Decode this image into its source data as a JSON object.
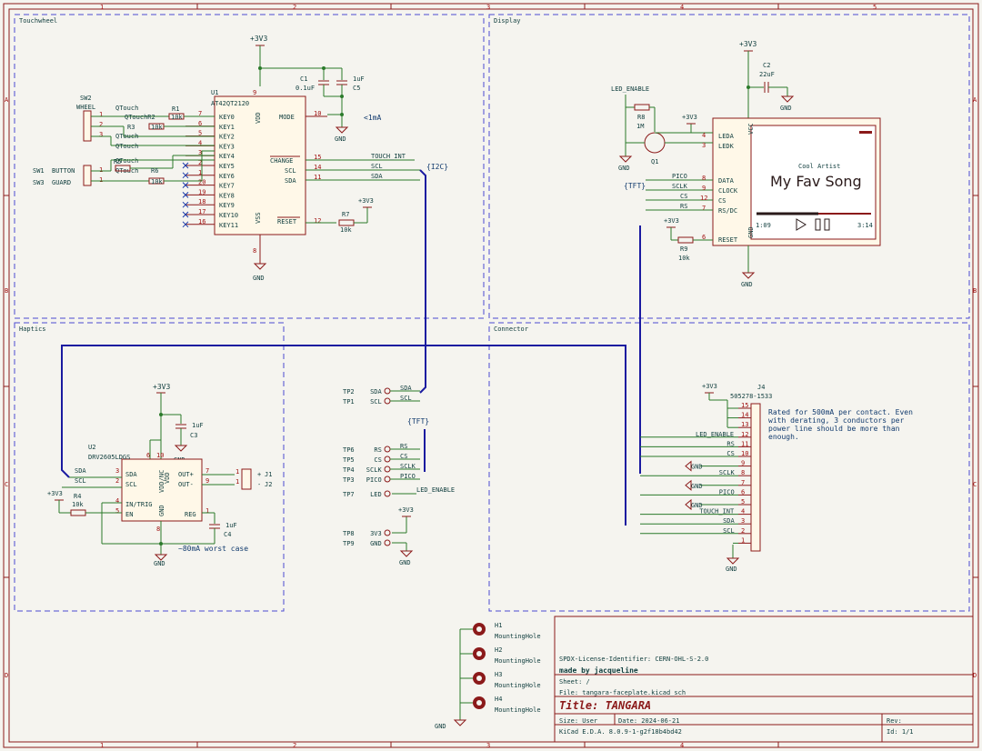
{
  "frame": {
    "cols": [
      "1",
      "2",
      "3",
      "4",
      "5"
    ],
    "rows": [
      "A",
      "B",
      "C",
      "D"
    ]
  },
  "sections": {
    "touchwheel": "Touchwheel",
    "display": "Display",
    "haptics": "Haptics",
    "connector": "Connector"
  },
  "power": {
    "v33": "+3V3",
    "gnd": "GND"
  },
  "touchwheel": {
    "sw2": "SW2",
    "wheel": "WHEEL",
    "sw1": "SW1",
    "button": "BUTTON",
    "sw3": "SW3",
    "guard": "GUARD",
    "qtouch": "QTouch",
    "qtouchr2": "QTouchR2",
    "r1": "R1",
    "r3": "R3",
    "r5": "R5",
    "r6": "R6",
    "res_val": "10k",
    "u1": "U1",
    "u1_part": "AT42QT2120",
    "c1": "C1",
    "c1_val": "0.1uF",
    "c5": "C5",
    "c5_val": "1uF",
    "keys": [
      "KEY0",
      "KEY1",
      "KEY2",
      "KEY3",
      "KEY4",
      "KEY5",
      "KEY6",
      "KEY7",
      "KEY8",
      "KEY9",
      "KEY10",
      "KEY11"
    ],
    "key_pins": [
      "7",
      "6",
      "5",
      "4",
      "3",
      "2",
      "1",
      "20",
      "19",
      "18",
      "17",
      "16"
    ],
    "vdd": "VDD",
    "vss": "VSS",
    "mode": "MODE",
    "change": "CHANGE",
    "scl": "SCL",
    "sda": "SDA",
    "reset": "RESET",
    "current": "<1mA",
    "touch_int": "TOUCH_INT",
    "i2c": "{I2C}",
    "r7": "R7",
    "r7_val": "10k"
  },
  "display": {
    "c2": "C2",
    "c2_val": "22uF",
    "led_enable": "LED_ENABLE",
    "r8": "R8",
    "r8_val": "1M",
    "q1": "Q1",
    "tft": "{TFT}",
    "pico": "PICO",
    "sclk": "SCLK",
    "cs": "CS",
    "rs": "RS",
    "r9": "R9",
    "r9_val": "10k",
    "pins": {
      "leda": "LEDA",
      "ledk": "LEDK",
      "data": "DATA",
      "clock": "CLOCK",
      "cs": "CS",
      "rsdc": "RS/DC",
      "reset": "RESET",
      "vcc": "VCC",
      "gnd": "GND"
    },
    "screen_artist": "Cool Artist",
    "screen_song": "My Fav Song",
    "screen_time_start": "1:09",
    "screen_time_end": "3:14"
  },
  "haptics": {
    "u2": "U2",
    "u2_part": "DRV2605LDGS",
    "c3": "C3",
    "c3_val": "1uF",
    "c4": "C4",
    "c4_val": "1uF",
    "r4": "R4",
    "r4_val": "10k",
    "sda": "SDA",
    "scl": "SCL",
    "in_trig": "IN/TRIG",
    "en": "EN",
    "vdd": "VDD",
    "vdd_nc": "VDD/NC",
    "gnd_pin": "GND",
    "outp": "OUT+",
    "outm": "OUT-",
    "reg": "REG",
    "j1": "J1",
    "j2": "J2",
    "worst_case": "~80mA worst case"
  },
  "testpoints": [
    {
      "tp": "TP2",
      "label": "SDA"
    },
    {
      "tp": "TP1",
      "label": "SCL"
    },
    {
      "tp": "TP6",
      "label": "RS"
    },
    {
      "tp": "TP5",
      "label": "CS"
    },
    {
      "tp": "TP4",
      "label": "SCLK"
    },
    {
      "tp": "TP3",
      "label": "PICO"
    },
    {
      "tp": "TP7",
      "label": "LED"
    },
    {
      "tp": "TP8",
      "label": "3V3"
    },
    {
      "tp": "TP9",
      "label": "GND"
    }
  ],
  "connector": {
    "j4": "J4",
    "j4_part": "505278-1533",
    "note": [
      "Rated for 500mA per contact. Even",
      "with derating, 3 conductors per",
      "power line should be more than",
      "enough."
    ],
    "pins": [
      {
        "n": "15",
        "net": ""
      },
      {
        "n": "14",
        "net": ""
      },
      {
        "n": "13",
        "net": ""
      },
      {
        "n": "12",
        "net": "LED_ENABLE"
      },
      {
        "n": "11",
        "net": "RS"
      },
      {
        "n": "10",
        "net": "CS"
      },
      {
        "n": "9",
        "net": "GND"
      },
      {
        "n": "8",
        "net": "SCLK"
      },
      {
        "n": "7",
        "net": "GND"
      },
      {
        "n": "6",
        "net": "PICO"
      },
      {
        "n": "5",
        "net": "GND"
      },
      {
        "n": "4",
        "net": "TOUCH_INT"
      },
      {
        "n": "3",
        "net": "SDA"
      },
      {
        "n": "2",
        "net": "SCL"
      },
      {
        "n": "1",
        "net": ""
      }
    ]
  },
  "holes": [
    {
      "ref": "H1",
      "name": "MountingHole"
    },
    {
      "ref": "H2",
      "name": "MountingHole"
    },
    {
      "ref": "H3",
      "name": "MountingHole"
    },
    {
      "ref": "H4",
      "name": "MountingHole"
    }
  ],
  "titleblock": {
    "license": "SPDX-License-Identifier: CERN-OHL-S-2.0",
    "author": "made by jacqueline",
    "sheet": "Sheet: /",
    "file": "File: tangara-faceplate.kicad_sch",
    "title": "Title: TANGARA",
    "size": "Size: User",
    "date": "Date: 2024-06-21",
    "rev": "Rev:",
    "kicad": "KiCad E.D.A. 8.0.9-1-g2f18b4bd42",
    "id": "Id: 1/1"
  }
}
